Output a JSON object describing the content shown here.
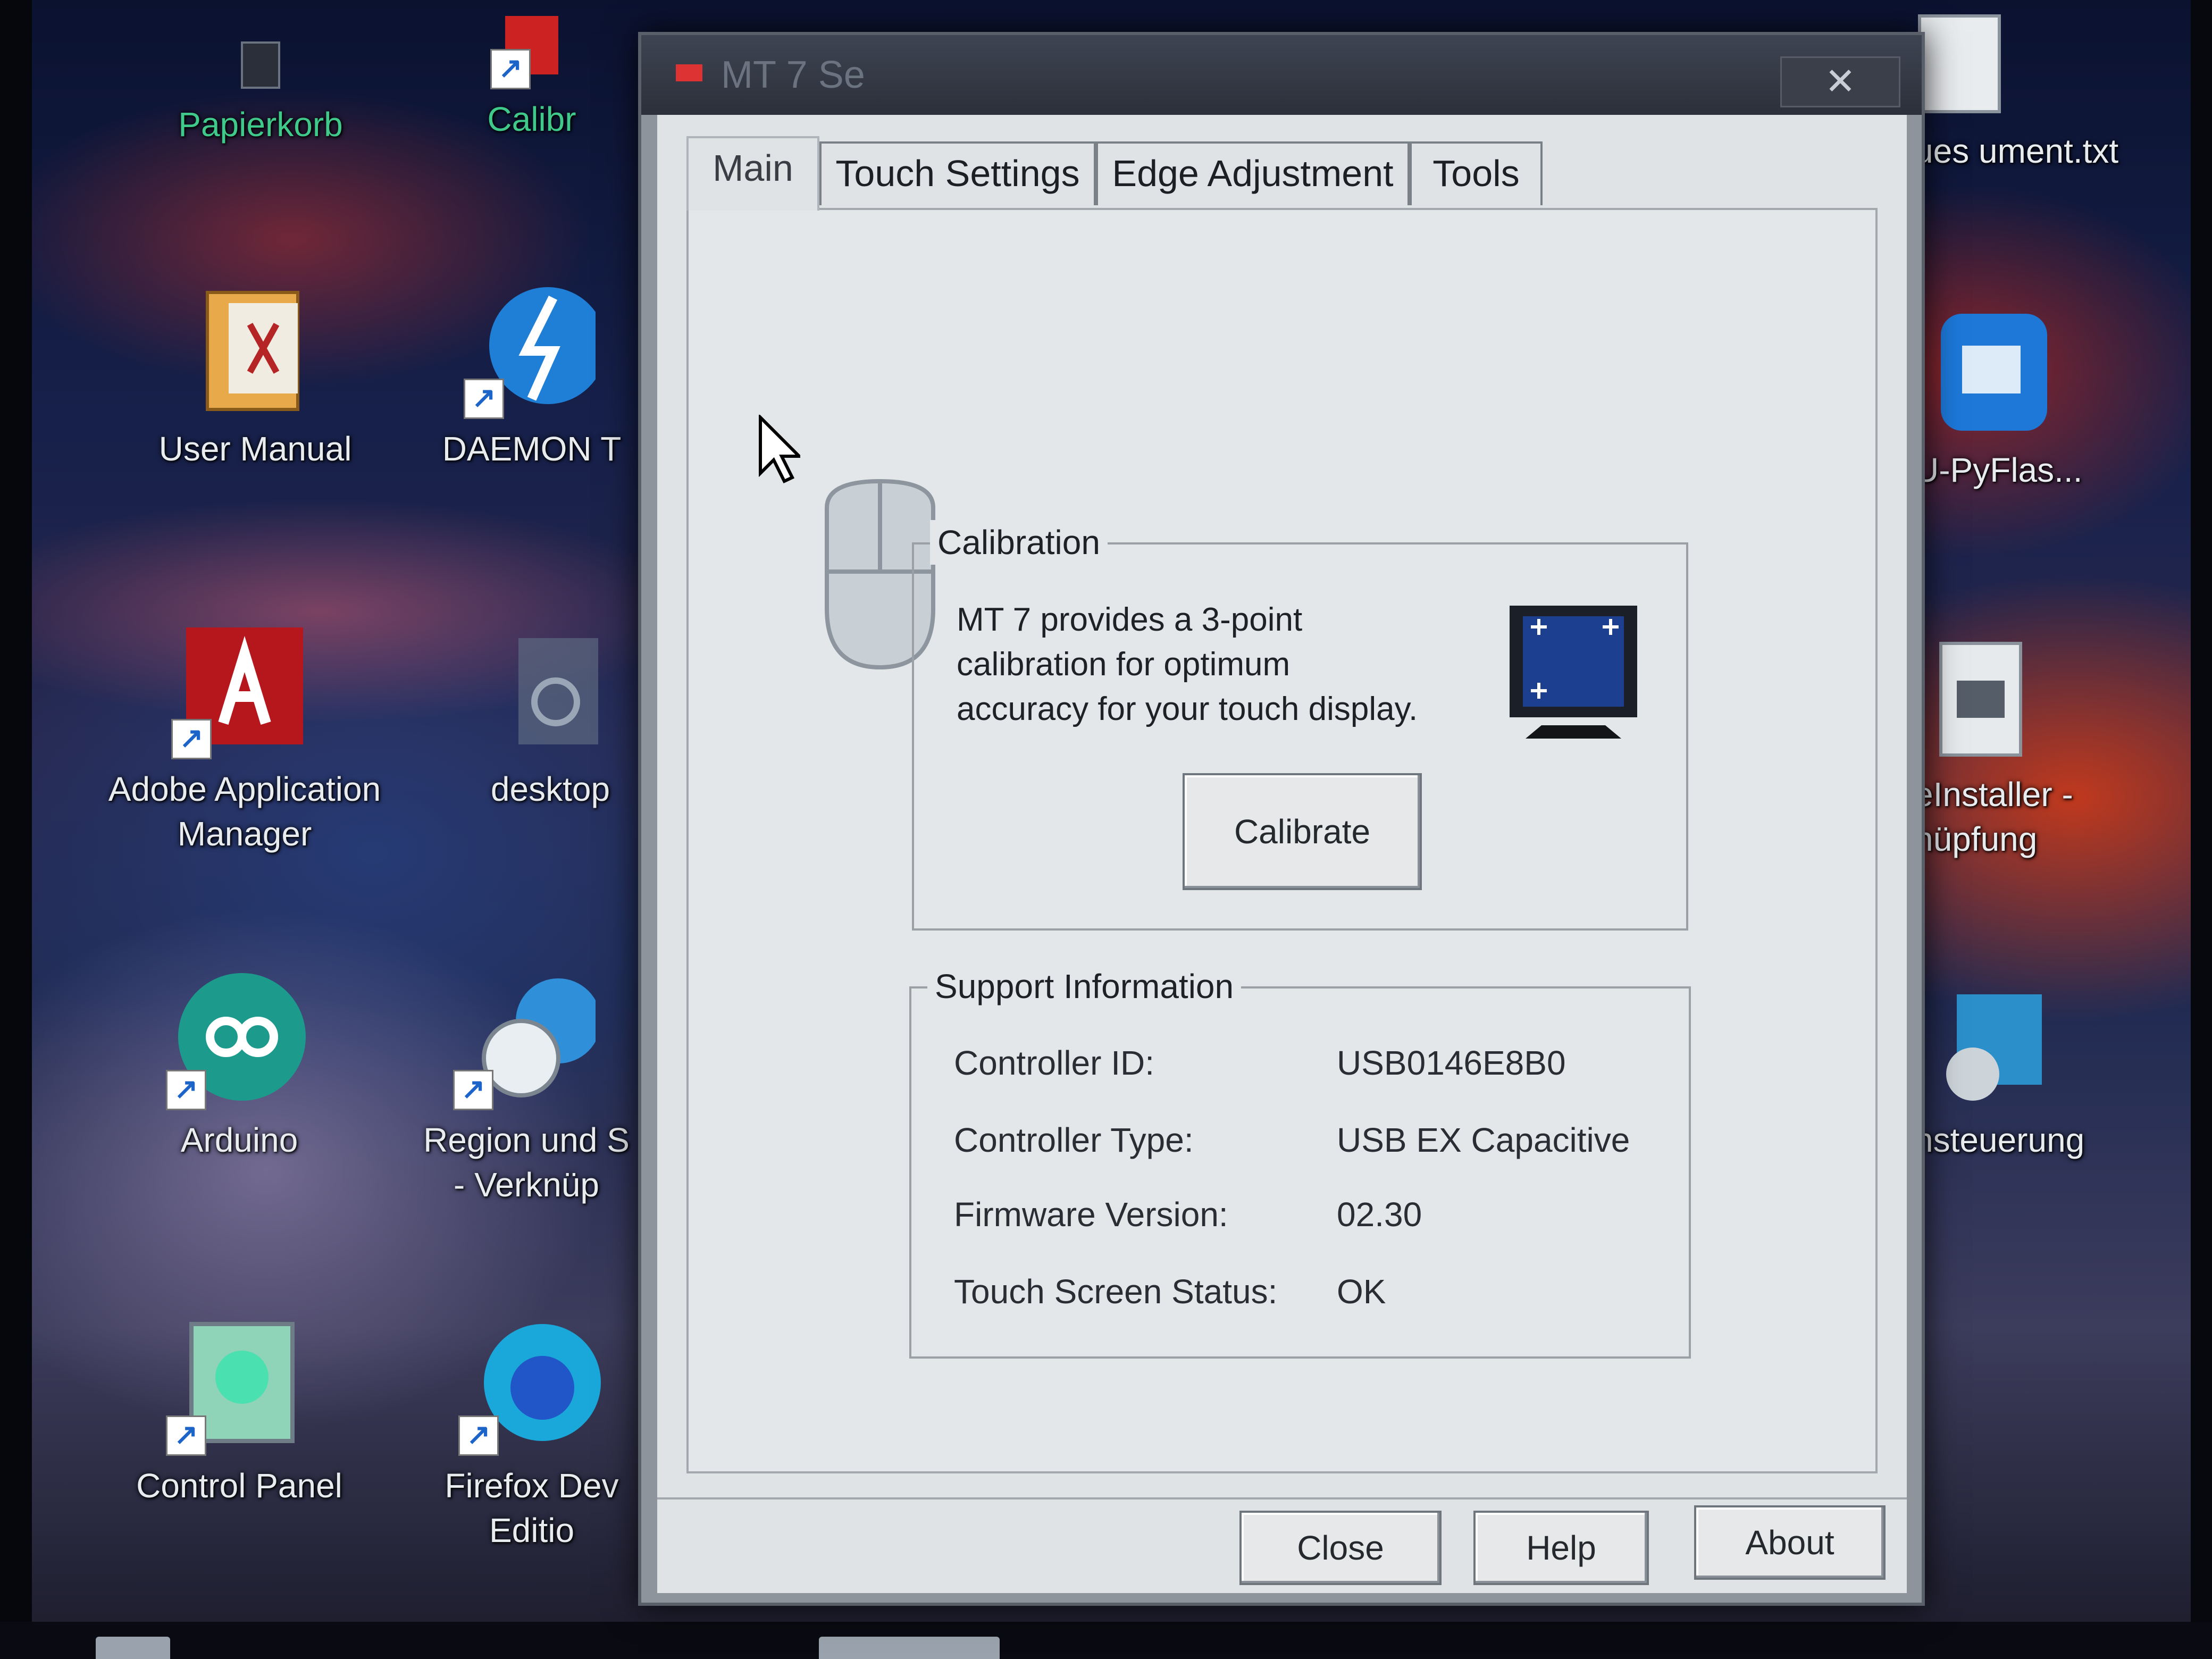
{
  "desktop": {
    "icons_left": [
      {
        "label": "Papierkorb",
        "icon": "recycle-bin-icon"
      },
      {
        "label": "User Manual",
        "icon": "pdf-folder-icon"
      },
      {
        "label": "Adobe Application Manager",
        "icon": "adobe-icon"
      },
      {
        "label": "Arduino",
        "icon": "arduino-icon"
      },
      {
        "label": "Control Panel",
        "icon": "control-panel-icon"
      }
    ],
    "icons_second": [
      {
        "label": "Calibr",
        "icon": "calibrate-tool-icon"
      },
      {
        "label": "DAEMON T",
        "icon": "daemon-tools-icon"
      },
      {
        "label": "desktop",
        "icon": "settings-file-icon"
      },
      {
        "label": "Region und S - Verknüp",
        "icon": "region-clock-icon"
      },
      {
        "label": "Firefox Dev Editio",
        "icon": "firefox-icon"
      }
    ],
    "icons_right": [
      {
        "label": "ues ument.txt",
        "icon": "text-file-icon"
      },
      {
        "label": "U-PyFlas...",
        "icon": "cloud-chip-icon"
      },
      {
        "label": "eInstaller - nüpfung",
        "icon": "installer-icon"
      },
      {
        "label": "nsteuerung",
        "icon": "device-control-icon"
      }
    ]
  },
  "window": {
    "title": "MT 7 Se",
    "close_glyph": "✕",
    "tabs": [
      {
        "label": "Main",
        "active": true
      },
      {
        "label": "Touch Settings",
        "active": false
      },
      {
        "label": "Edge Adjustment",
        "active": false
      },
      {
        "label": "Tools",
        "active": false
      }
    ],
    "calibration": {
      "legend": "Calibration",
      "text_line1": "MT 7 provides a 3-point",
      "text_line2": "calibration for optimum",
      "text_line3": "accuracy for your touch display.",
      "button_label": "Calibrate"
    },
    "support": {
      "legend": "Support Information",
      "rows": [
        {
          "key": "Controller ID:",
          "value": "USB0146E8B0"
        },
        {
          "key": "Controller Type:",
          "value": "USB EX Capacitive"
        },
        {
          "key": "Firmware Version:",
          "value": "02.30"
        },
        {
          "key": "Touch Screen Status:",
          "value": "OK"
        }
      ]
    },
    "buttons": {
      "close": "Close",
      "help": "Help",
      "about": "About"
    }
  }
}
